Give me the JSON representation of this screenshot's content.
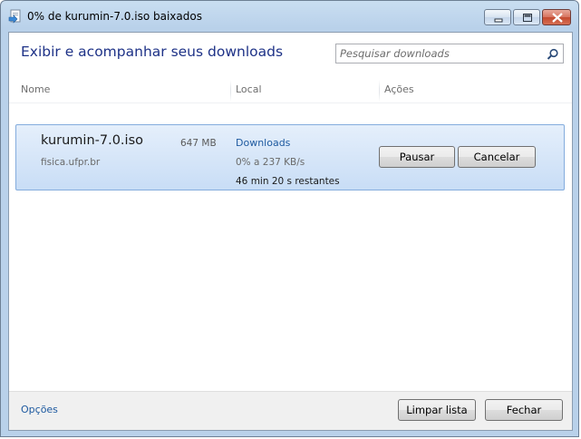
{
  "window": {
    "title": "0% de kurumin-7.0.iso baixados",
    "title_icon": "downloads-window-icon"
  },
  "header": {
    "title": "Exibir e acompanhar seus downloads",
    "search_placeholder": "Pesquisar downloads",
    "search_icon": "search-icon"
  },
  "columns": {
    "name": "Nome",
    "location": "Local",
    "actions": "Ações"
  },
  "download": {
    "file_name": "kurumin-7.0.iso",
    "size": "647 MB",
    "source": "fisica.ufpr.br",
    "location": "Downloads",
    "progress_text": "0% a 237 KB/s",
    "remaining": "46 min 20 s restantes",
    "pause_label": "Pausar",
    "cancel_label": "Cancelar"
  },
  "footer": {
    "options_label": "Opções",
    "clear_label": "Limpar lista",
    "close_label": "Fechar"
  },
  "colors": {
    "header_title": "#1e3287",
    "link": "#1e5aa0",
    "selection_top": "#e5effb",
    "selection_bottom": "#c8ddf6",
    "selection_border": "#84acdd"
  }
}
